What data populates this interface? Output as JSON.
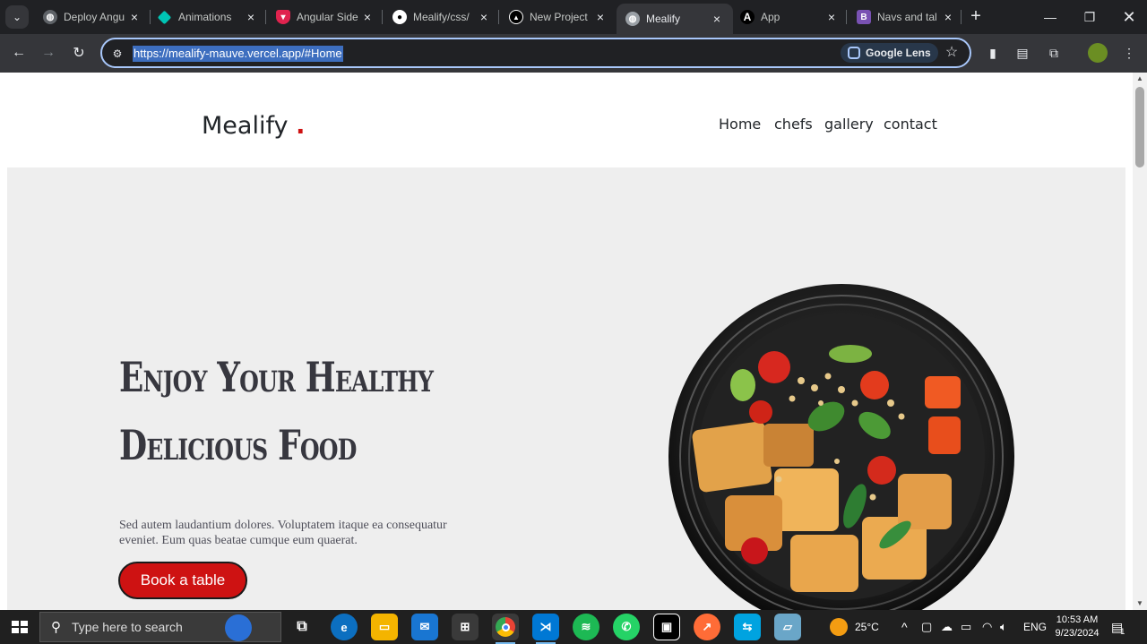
{
  "browser": {
    "tabs": [
      {
        "title": "Deploy Angu",
        "favicon": "globe-icon",
        "color": "#5f6368"
      },
      {
        "title": "Animations",
        "favicon": "angular-diamond-icon",
        "color": "#00c4b4"
      },
      {
        "title": "Angular Side",
        "favicon": "shield-icon",
        "color": "#e0234e"
      },
      {
        "title": "Mealify/css/",
        "favicon": "github-icon",
        "color": "#ffffff"
      },
      {
        "title": "New Project",
        "favicon": "vercel-triangle-icon",
        "color": "#000000"
      },
      {
        "title": "Mealify",
        "favicon": "globe-icon",
        "color": "#5f6368",
        "active": true
      },
      {
        "title": "App",
        "favicon": "angular-a-icon",
        "color": "#000000"
      },
      {
        "title": "Navs and tal",
        "favicon": "bootstrap-icon",
        "color": "#7952b3"
      }
    ],
    "url": "https://mealify-mauve.vercel.app/#Home",
    "lens_label": "Google Lens"
  },
  "site": {
    "logo": "Mealify",
    "logo_dot": ".",
    "nav": [
      "Home",
      "chefs",
      "gallery",
      "contact"
    ],
    "hero_title_line1": "Enjoy Your Healthy",
    "hero_title_line2": "Delicious Food",
    "hero_text": "Sed autem laudantium dolores. Voluptatem itaque ea consequatur eveniet. Eum quas beatae cumque eum quaerat.",
    "cta": "Book a table",
    "accent": "#ce1212"
  },
  "taskbar": {
    "search_placeholder": "Type here to search",
    "weather": "25°C",
    "language": "ENG",
    "time": "10:53 AM",
    "date": "9/23/2024",
    "notification_count": "1"
  }
}
